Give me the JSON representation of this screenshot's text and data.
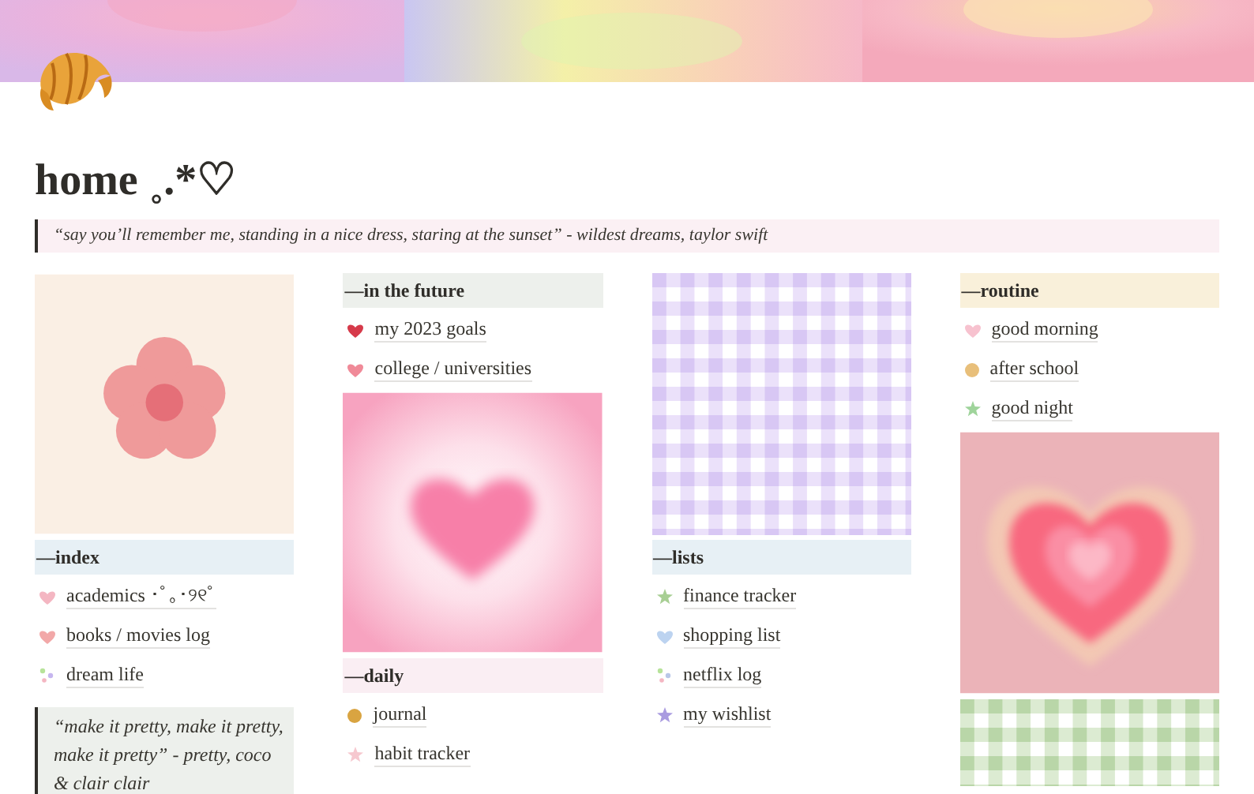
{
  "cover": {
    "kind": "picture"
  },
  "title": "home ˳.*♡",
  "quote": "“say you’ll remember me, standing in a nice dress, staring at the sunset” - wildest dreams, taylor swift",
  "columns": [
    {
      "blocks": [
        {
          "kind": "picture"
        },
        {
          "kind": "header",
          "text": "—index",
          "color": "#e7f0f5"
        },
        {
          "kind": "link",
          "text": "academics ･ﾟ｡･୨୧ﾟ"
        },
        {
          "kind": "link",
          "text": "books / movies log"
        },
        {
          "kind": "link",
          "text": "dream life"
        },
        {
          "kind": "quote",
          "text": "“make it pretty, make it pretty, make it pretty” - pretty, coco & clair clair"
        }
      ]
    },
    {
      "blocks": [
        {
          "kind": "header",
          "text": "—in the future",
          "color": "#edf0ec"
        },
        {
          "kind": "link",
          "text": "my 2023 goals"
        },
        {
          "kind": "link",
          "text": "college / universities"
        },
        {
          "kind": "picture"
        },
        {
          "kind": "header",
          "text": "—daily",
          "color": "#faeef3"
        },
        {
          "kind": "link",
          "text": "journal"
        },
        {
          "kind": "link",
          "text": "habit tracker"
        }
      ]
    },
    {
      "blocks": [
        {
          "kind": "picture"
        },
        {
          "kind": "header",
          "text": "—lists",
          "color": "#e7f0f5"
        },
        {
          "kind": "link",
          "text": "finance tracker"
        },
        {
          "kind": "link",
          "text": "shopping list"
        },
        {
          "kind": "link",
          "text": "netflix log"
        },
        {
          "kind": "link",
          "text": "my wishlist"
        }
      ]
    },
    {
      "blocks": [
        {
          "kind": "header",
          "text": "—routine",
          "color": "#f9f0da"
        },
        {
          "kind": "link",
          "text": "good morning"
        },
        {
          "kind": "link",
          "text": "after school"
        },
        {
          "kind": "link",
          "text": "good night"
        },
        {
          "kind": "picture"
        },
        {
          "kind": "picture"
        }
      ]
    }
  ]
}
